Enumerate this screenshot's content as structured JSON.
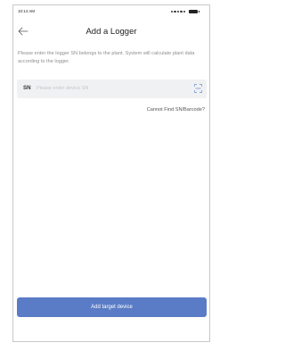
{
  "status_bar": {
    "time": "10:14 AM",
    "signal_icon": "signal-dots-icon",
    "battery_icon": "battery-icon"
  },
  "header": {
    "back_icon": "arrow-left-icon",
    "title": "Add a Logger"
  },
  "instruction": "Please enter the logger SN belongs to the plant. System will calculate plant data according to the logger.",
  "sn_field": {
    "label": "SN",
    "value": "",
    "placeholder": "Please enter device SN",
    "scan_icon": "scan-barcode-icon"
  },
  "cannot_find_link": "Cannot Find SN/Barcode?",
  "primary_button": {
    "label": "Add target device"
  },
  "colors": {
    "primary": "#5a7cc6",
    "field_background": "#f0f1f3",
    "muted_text": "#8e8e8e",
    "placeholder": "#c4c6ca",
    "scan_icon": "#6a8fd0"
  }
}
